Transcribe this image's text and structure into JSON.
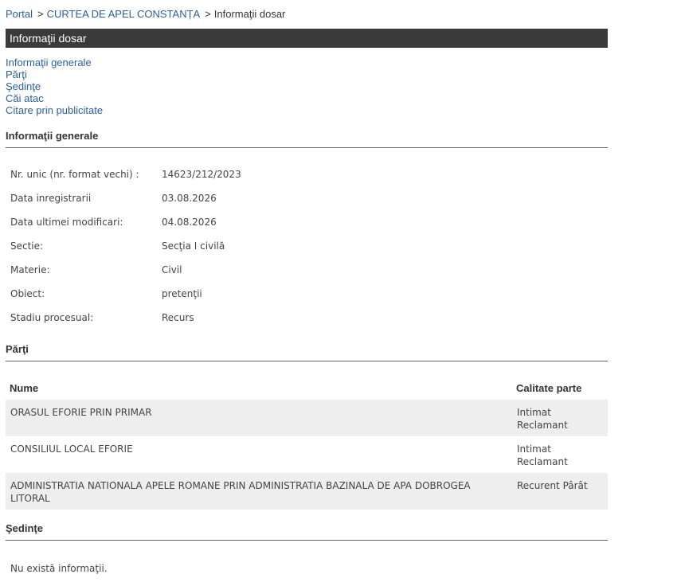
{
  "breadcrumb": {
    "items": [
      {
        "label": "Portal"
      },
      {
        "label": "CURTEA DE APEL CONSTANȚA"
      }
    ],
    "separator": ">",
    "current": "Informaţii dosar"
  },
  "title_bar": {
    "title": "Informaţii dosar"
  },
  "quick_links": [
    {
      "label": "Informaţii generale"
    },
    {
      "label": "Părţi"
    },
    {
      "label": "Şedinţe"
    },
    {
      "label": "Căi atac"
    },
    {
      "label": "Citare prin publicitate"
    }
  ],
  "general_info": {
    "heading": "Informaţii generale",
    "rows": [
      {
        "label": "Nr. unic (nr. format vechi) :",
        "value": "14623/212/2023"
      },
      {
        "label": "Data inregistrarii",
        "value": "03.08.2026"
      },
      {
        "label": "Data ultimei modificari:",
        "value": "04.08.2026"
      },
      {
        "label": "Sectie:",
        "value": "Secţia I civilă"
      },
      {
        "label": "Materie:",
        "value": "Civil"
      },
      {
        "label": "Obiect:",
        "value": "pretenţii"
      },
      {
        "label": "Stadiu procesual:",
        "value": "Recurs"
      }
    ]
  },
  "parties": {
    "heading": "Părţi",
    "columns": {
      "name": "Nume",
      "role": "Calitate parte"
    },
    "rows": [
      {
        "name": "ORASUL EFORIE PRIN PRIMAR",
        "role_lines": [
          "Intimat",
          "Reclamant"
        ]
      },
      {
        "name": "CONSILIUL LOCAL EFORIE",
        "role_lines": [
          "Intimat",
          "Reclamant"
        ]
      },
      {
        "name": "ADMINISTRATIA NATIONALA APELE ROMANE PRIN ADMINISTRATIA BAZINALA DE APA DOBROGEA LITORAL",
        "role_lines": [
          "Recurent Pârât"
        ]
      }
    ]
  },
  "hearings": {
    "heading": "Şedinţe",
    "empty_text": "Nu există informaţii."
  }
}
